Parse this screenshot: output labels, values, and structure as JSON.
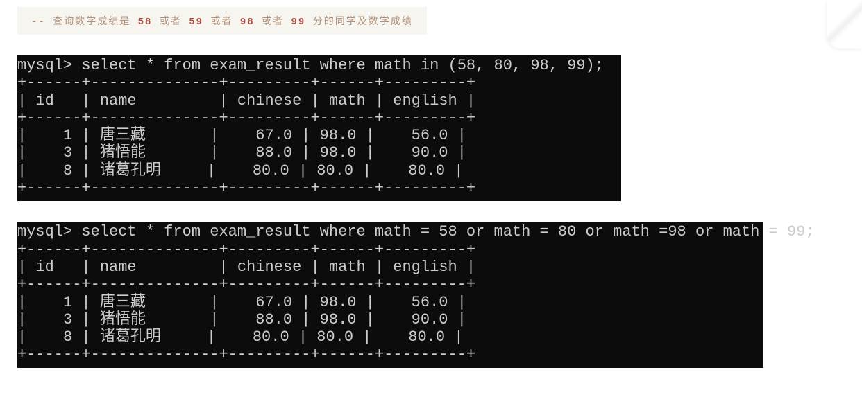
{
  "comment": {
    "dash": "--",
    "prefix": "查询数学成绩是",
    "n1": "58",
    "or1": "或者",
    "n2": "59",
    "or2": "或者",
    "n3": "98",
    "or3": "或者",
    "n4": "99",
    "suffix": "分的同学及数学成绩"
  },
  "terminal1": {
    "prompt": "mysql> select * from exam_result where math in (58, 80, 98, 99);",
    "border_top": "+------+--------------+---------+------+---------+",
    "header": "| id   | name         | chinese | math | english |",
    "border_mid": "+------+--------------+---------+------+---------+",
    "row1": "|    1 | 唐三藏       |    67.0 | 98.0 |    56.0 |",
    "row2": "|    3 | 猪悟能       |    88.0 | 98.0 |    90.0 |",
    "row3": "|    8 | 诸葛孔明     |    80.0 | 80.0 |    80.0 |",
    "border_bot": "+------+--------------+---------+------+---------+"
  },
  "terminal2": {
    "prompt": "mysql> select * from exam_result where math = 58 or math = 80 or math =98 or math = 99;",
    "border_top": "+------+--------------+---------+------+---------+",
    "header": "| id   | name         | chinese | math | english |",
    "border_mid": "+------+--------------+---------+------+---------+",
    "row1": "|    1 | 唐三藏       |    67.0 | 98.0 |    56.0 |",
    "row2": "|    3 | 猪悟能       |    88.0 | 98.0 |    90.0 |",
    "row3": "|    8 | 诸葛孔明     |    80.0 | 80.0 |    80.0 |",
    "border_bot": "+------+--------------+---------+------+---------+"
  },
  "chart_data": {
    "type": "table",
    "title": "exam_result query results",
    "columns": [
      "id",
      "name",
      "chinese",
      "math",
      "english"
    ],
    "rows": [
      {
        "id": 1,
        "name": "唐三藏",
        "chinese": 67.0,
        "math": 98.0,
        "english": 56.0
      },
      {
        "id": 3,
        "name": "猪悟能",
        "chinese": 88.0,
        "math": 98.0,
        "english": 90.0
      },
      {
        "id": 8,
        "name": "诸葛孔明",
        "chinese": 80.0,
        "math": 80.0,
        "english": 80.0
      }
    ]
  }
}
